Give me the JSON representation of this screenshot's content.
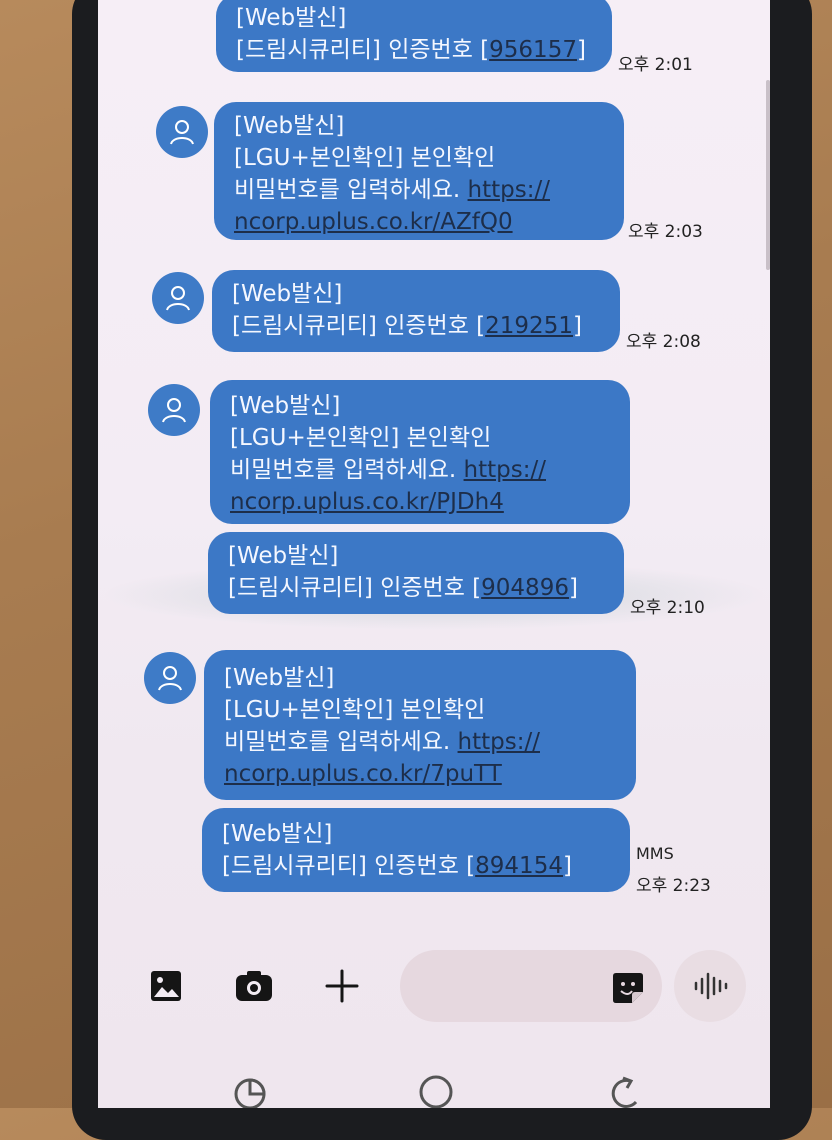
{
  "messages": [
    {
      "lines": [
        "[Web발신]",
        "[드림시큐리티] 인증번호 [",
        "956157",
        "]"
      ],
      "time": "오후 2:01"
    },
    {
      "lines": [
        "[Web발신]",
        "[LGU+본인확인] 본인확인",
        "비밀번호를 입력하세요. ",
        "https://",
        "ncorp.uplus.co.kr/AZfQ0"
      ],
      "time": "오후 2:03"
    },
    {
      "lines": [
        "[Web발신]",
        "[드림시큐리티] 인증번호 [",
        "219251",
        "]"
      ],
      "time": "오후 2:08"
    },
    {
      "lines": [
        "[Web발신]",
        "[LGU+본인확인] 본인확인",
        "비밀번호를 입력하세요. ",
        "https://",
        "ncorp.uplus.co.kr/PJDh4"
      ]
    },
    {
      "lines": [
        "[Web발신]",
        "[드림시큐리티] 인증번호 [",
        "904896",
        "]"
      ],
      "time": "오후 2:10"
    },
    {
      "lines": [
        "[Web발신]",
        "[LGU+본인확인] 본인확인",
        "비밀번호를 입력하세요. ",
        "https://",
        "ncorp.uplus.co.kr/7puTT"
      ]
    },
    {
      "lines": [
        "[Web발신]",
        "[드림시큐리티] 인증번호 [",
        "894154",
        "]"
      ],
      "time": "오후 2:23",
      "type": "MMS"
    }
  ],
  "icons": {
    "gallery": "gallery-icon",
    "camera": "camera-icon",
    "plus": "plus-icon",
    "sticker": "sticker-icon",
    "voice": "voice-icon",
    "avatar": "person-icon"
  },
  "colors": {
    "bubble": "#3c78c6",
    "avatar": "#3e7bc7",
    "background": "#f3ecf4"
  }
}
